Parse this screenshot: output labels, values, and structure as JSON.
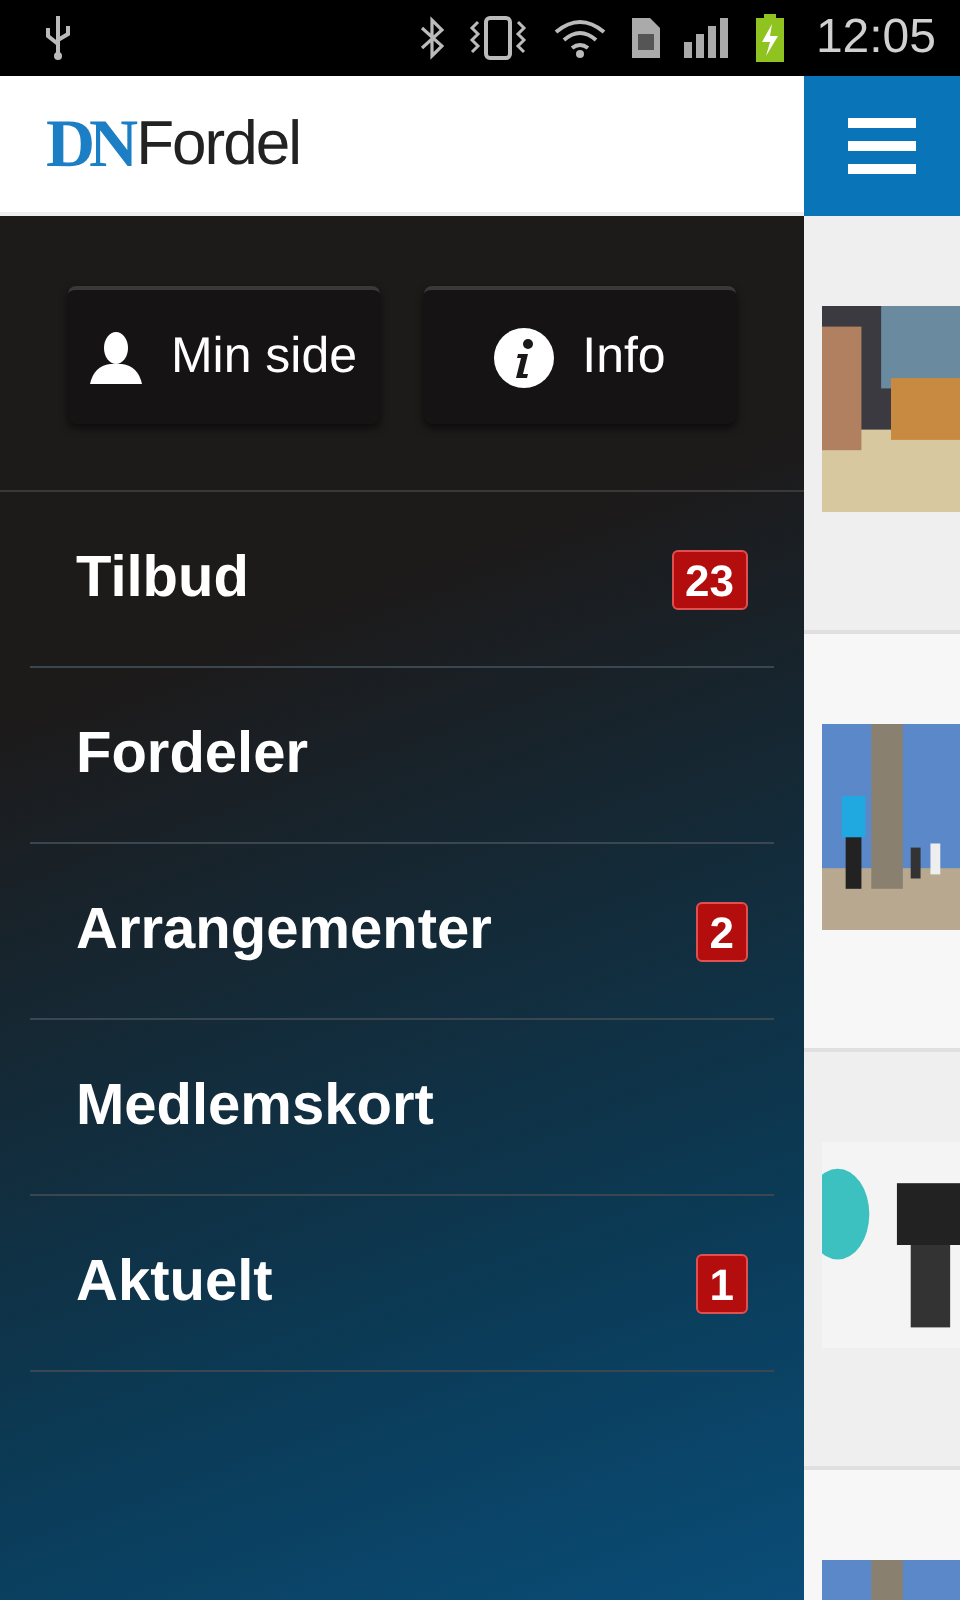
{
  "status_bar": {
    "time": "12:05"
  },
  "header": {
    "logo_mark": "DN",
    "logo_text": "Fordel"
  },
  "drawer": {
    "buttons": [
      {
        "kind": "user",
        "label": "Min side"
      },
      {
        "kind": "info",
        "label": "Info"
      }
    ],
    "items": [
      {
        "label": "Tilbud",
        "badge": "23"
      },
      {
        "label": "Fordeler"
      },
      {
        "label": "Arrangementer",
        "badge": "2"
      },
      {
        "label": "Medlemskort"
      },
      {
        "label": "Aktuelt",
        "badge": "1"
      }
    ]
  }
}
